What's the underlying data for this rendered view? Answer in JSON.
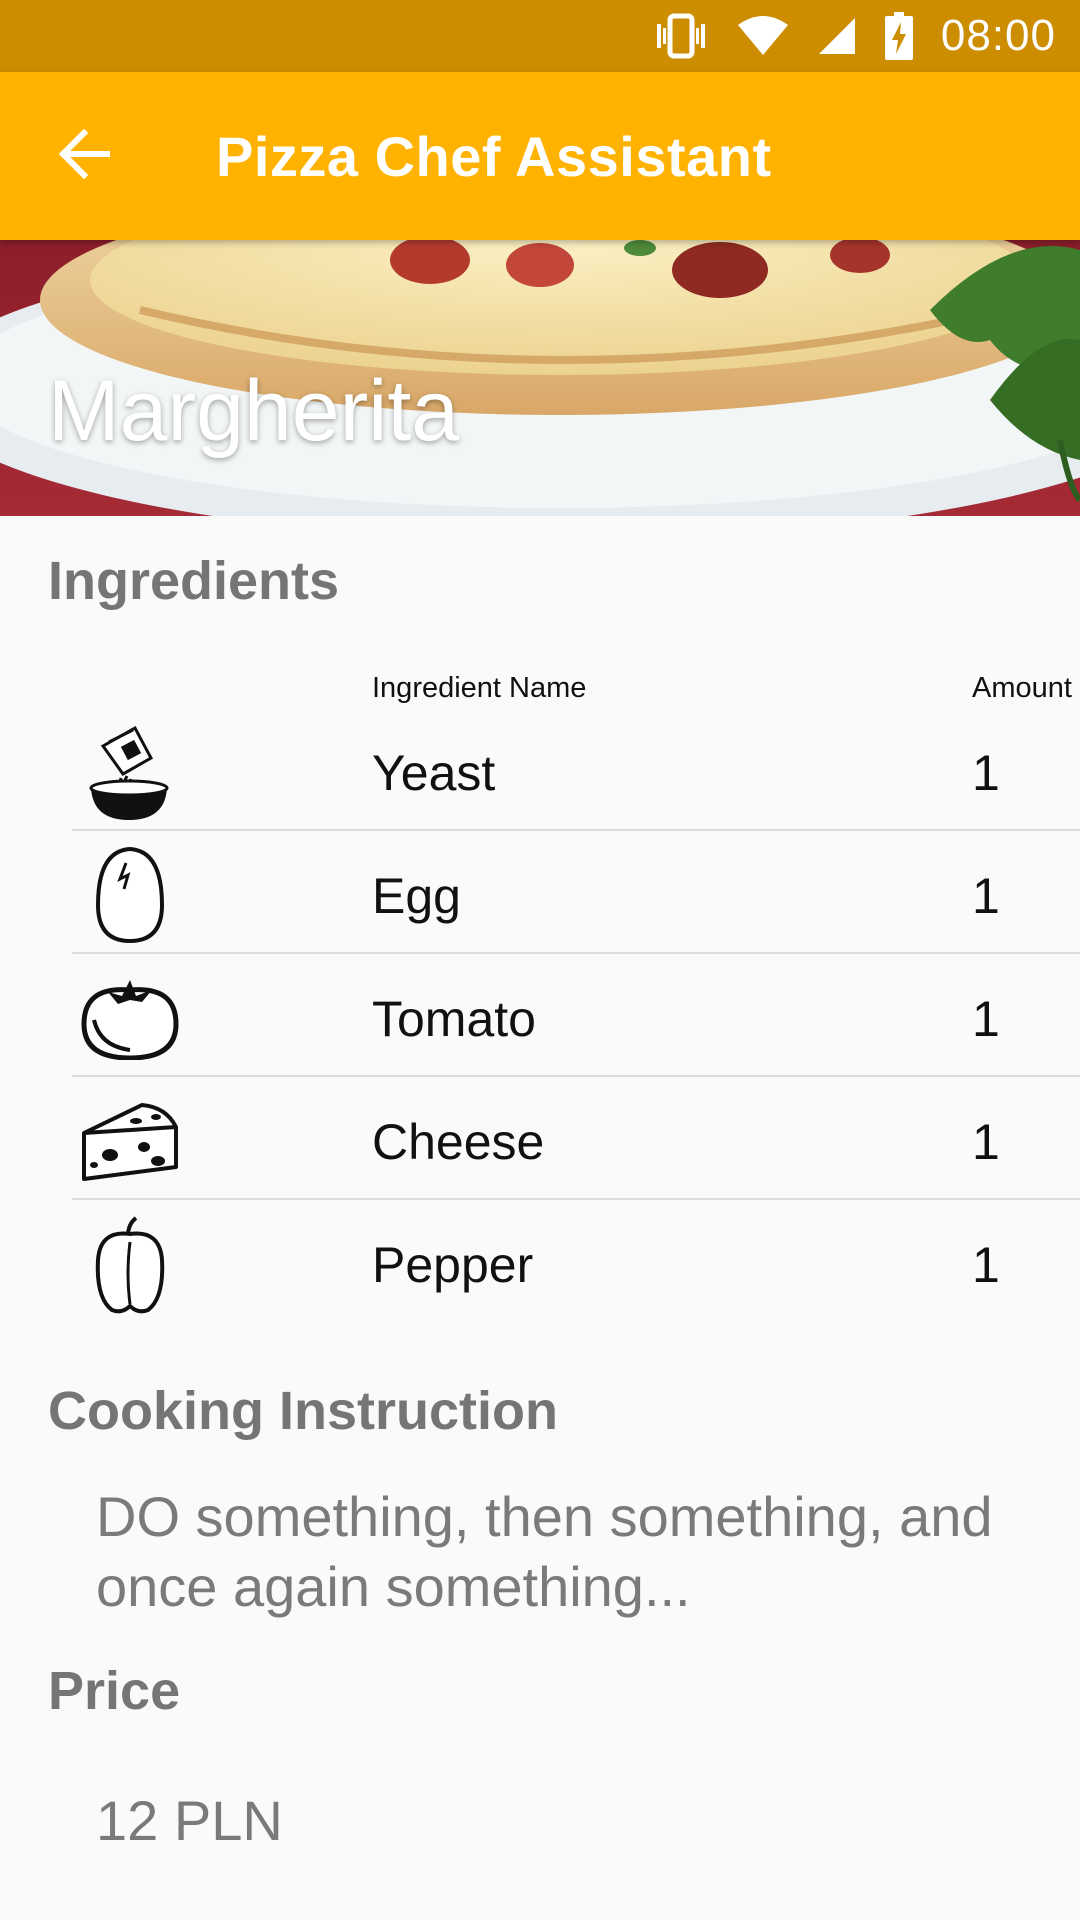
{
  "status_bar": {
    "time": "08:00"
  },
  "app_bar": {
    "title": "Pizza Chef Assistant"
  },
  "recipe": {
    "name": "Margherita"
  },
  "ingredients": {
    "heading": "Ingredients",
    "col_name": "Ingredient Name",
    "col_amount": "Amount",
    "items": [
      {
        "icon": "yeast-icon",
        "name": "Yeast",
        "amount": "1"
      },
      {
        "icon": "egg-icon",
        "name": "Egg",
        "amount": "1"
      },
      {
        "icon": "tomato-icon",
        "name": "Tomato",
        "amount": "1"
      },
      {
        "icon": "cheese-icon",
        "name": "Cheese",
        "amount": "1"
      },
      {
        "icon": "pepper-icon",
        "name": "Pepper",
        "amount": "1"
      }
    ]
  },
  "instructions": {
    "heading": "Cooking Instruction",
    "text": "DO something, then something, and once again something..."
  },
  "price": {
    "heading": "Price",
    "value": "12 PLN"
  },
  "colors": {
    "status_bar": "#cc8d00",
    "app_bar": "#ffb300",
    "section_heading": "#757575",
    "body_text": "#7a7a7a"
  }
}
